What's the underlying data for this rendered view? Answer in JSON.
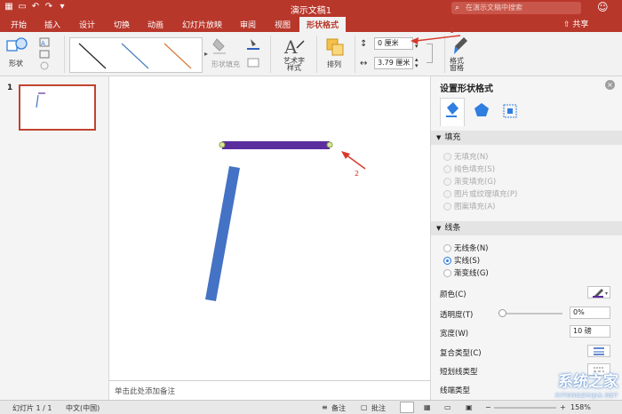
{
  "window": {
    "title": "演示文稿1",
    "search_placeholder": "在演示文稿中搜索"
  },
  "tabs": [
    "开始",
    "插入",
    "设计",
    "切换",
    "动画",
    "幻灯片放映",
    "审阅",
    "视图",
    "形状格式"
  ],
  "share_label": "共享",
  "ribbon": {
    "shape": "形状",
    "shape_fill": "形状填充",
    "wordart": "艺术字\n样式",
    "arrange": "排列",
    "height": "0 厘米",
    "width": "3.79 厘米",
    "format_pane": "格式\n窗格"
  },
  "annotations": {
    "one": "1",
    "two": "2"
  },
  "slides": {
    "number": "1"
  },
  "notes_placeholder": "单击此处添加备注",
  "format_pane": {
    "title": "设置形状格式",
    "fill": {
      "header": "填充",
      "options": [
        "无填充(N)",
        "纯色填充(S)",
        "渐变填充(G)",
        "图片或纹理填充(P)",
        "图案填充(A)"
      ]
    },
    "line": {
      "header": "线条",
      "options": [
        "无线条(N)",
        "实线(S)",
        "渐变线(G)"
      ],
      "selected": "实线(S)",
      "color_label": "颜色(C)",
      "transparency_label": "透明度(T)",
      "transparency_value": "0%",
      "width_label": "宽度(W)",
      "width_value": "10 磅",
      "compound_label": "复合类型(C)",
      "dash_label": "短划线类型",
      "cap_label": "线端类型"
    }
  },
  "status": {
    "slide": "幻灯片 1 / 1",
    "language": "中文(中国)",
    "notes": "备注",
    "comments": "批注",
    "zoom": "158%"
  },
  "watermark": {
    "text": "系统之家",
    "url": "XITONGZHIJIA.NET"
  },
  "colors": {
    "accent": "#b8372b",
    "purple_line": "#5b2c9e",
    "blue_line": "#4472c4",
    "arrow": "#d6392b"
  }
}
